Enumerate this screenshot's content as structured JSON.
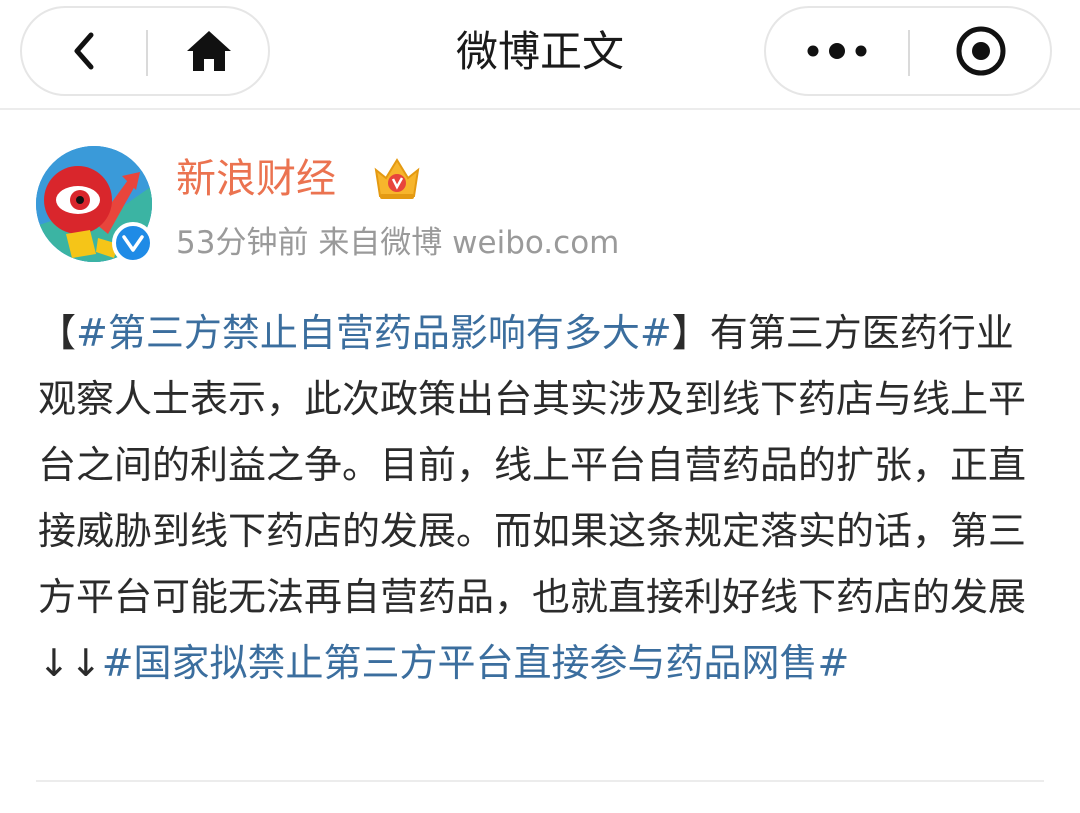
{
  "nav": {
    "title": "微博正文",
    "back_icon": "chevron-left-icon",
    "home_icon": "home-icon",
    "more_icon": "more-dots-icon",
    "close_icon": "target-circle-icon"
  },
  "author": {
    "name": "新浪财经",
    "avatar_icon": "sina-finance-logo",
    "verified_icon": "verified-badge-icon",
    "vip_icon": "crown-vip-icon",
    "time": "53分钟前",
    "source": "来自微博 weibo.com"
  },
  "post": {
    "open_bracket": "【",
    "topic1": "#第三方禁止自营药品影响有多大#",
    "close_bracket": "】",
    "body": "有第三方医药行业观察人士表示，此次政策出台其实涉及到线下药店与线上平台之间的利益之争。目前，线上平台自营药品的扩张，正直接威胁到线下药店的发展。而如果这条规定落实的话，第三方平台可能无法再自营药品，也就直接利好线下药店的发展↓↓",
    "topic2": "#国家拟禁止第三方平台直接参与药品网售#"
  },
  "colors": {
    "name": "#eb7350",
    "topic": "#3b6e9e",
    "meta": "#9a9a9a",
    "verified": "#1f8be6"
  }
}
